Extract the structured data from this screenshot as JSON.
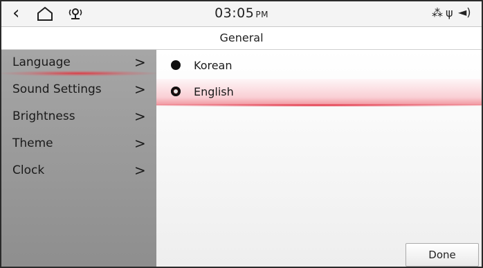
{
  "status": {
    "back_icon": "chevron-left-icon",
    "home_icon": "home-icon",
    "nav_icon": "location-signal-icon",
    "time": "03:05",
    "ampm": "PM",
    "bt_icon": "bluetooth-icon",
    "usb_icon": "usb-icon",
    "volume_icon": "speaker-icon"
  },
  "header": {
    "title": "General"
  },
  "sidebar": {
    "items": [
      {
        "label": "Language",
        "chevron": ">",
        "active": true
      },
      {
        "label": "Sound Settings",
        "chevron": ">"
      },
      {
        "label": "Brightness",
        "chevron": ">"
      },
      {
        "label": "Theme",
        "chevron": ">"
      },
      {
        "label": "Clock",
        "chevron": ">"
      }
    ]
  },
  "main": {
    "options": [
      {
        "label": "Korean"
      },
      {
        "label": "English",
        "selected": true
      }
    ]
  },
  "footer": {
    "done_label": "Done"
  },
  "colors": {
    "accent": "#e0323c",
    "sidebar_bg": "#9a9a9a"
  }
}
